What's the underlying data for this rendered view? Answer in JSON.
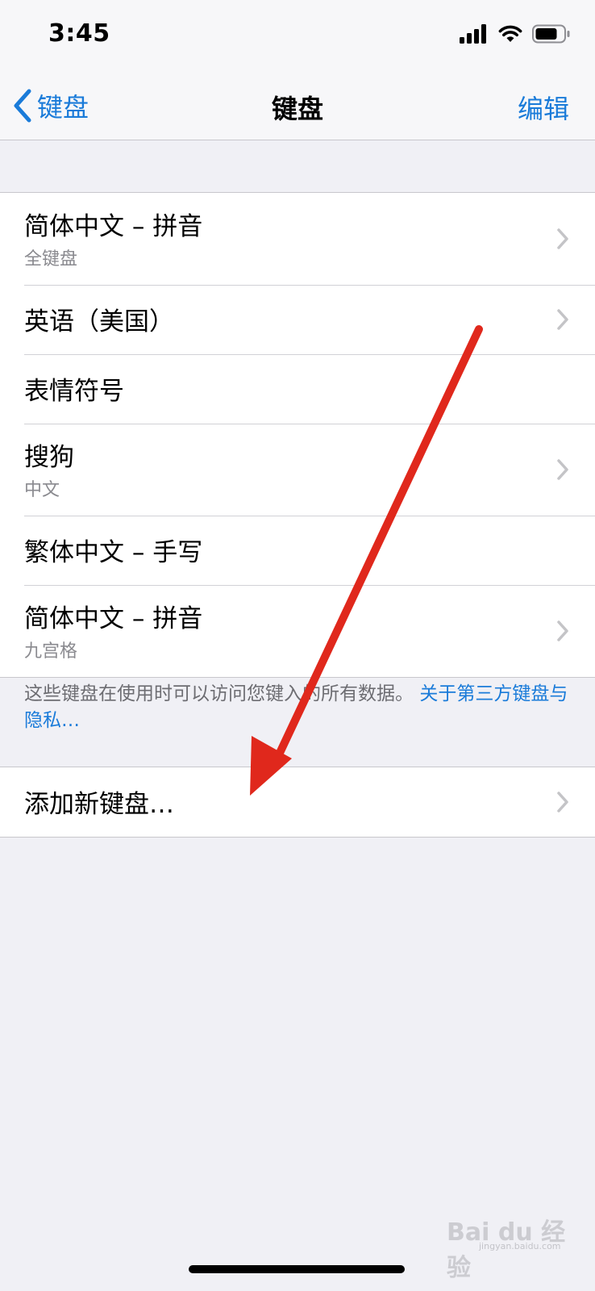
{
  "status_bar": {
    "time": "3:45"
  },
  "nav": {
    "back_label": "键盘",
    "title": "键盘",
    "edit_label": "编辑"
  },
  "keyboards": [
    {
      "title": "简体中文 – 拼音",
      "subtitle": "全键盘",
      "has_chevron": true
    },
    {
      "title": "英语（美国）",
      "subtitle": "",
      "has_chevron": true
    },
    {
      "title": "表情符号",
      "subtitle": "",
      "has_chevron": false
    },
    {
      "title": "搜狗",
      "subtitle": "中文",
      "has_chevron": true
    },
    {
      "title": "繁体中文 – 手写",
      "subtitle": "",
      "has_chevron": false
    },
    {
      "title": "简体中文 – 拼音",
      "subtitle": "九宫格",
      "has_chevron": true
    }
  ],
  "footer": {
    "note": "这些键盘在使用时可以访问您键入的所有数据。",
    "link": "关于第三方键盘与隐私…"
  },
  "add_keyboard": {
    "label": "添加新键盘…"
  },
  "watermark": {
    "text": "Bai du 经验",
    "sub": "jingyan.baidu.com"
  },
  "colors": {
    "accent": "#1a7bd9",
    "arrow": "#e0281c",
    "background": "#f0f0f5"
  }
}
